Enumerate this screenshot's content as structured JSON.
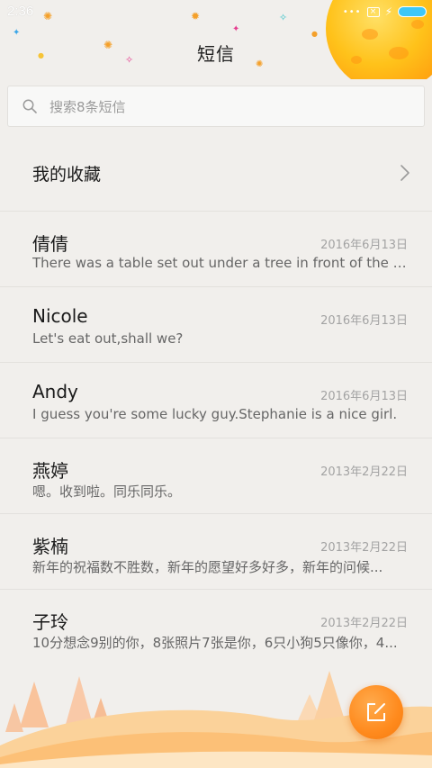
{
  "status_bar": {
    "time": "2:36",
    "battery_color": "#3ec7f7"
  },
  "header": {
    "title": "短信"
  },
  "search": {
    "placeholder": "搜索8条短信"
  },
  "favorites": {
    "label": "我的收藏"
  },
  "conversations": [
    {
      "name": "倩倩",
      "date": "2016年6月13日",
      "snippet": "There was a table set out under a tree in front of the ho..."
    },
    {
      "name": "Nicole",
      "date": "2016年6月13日",
      "snippet": "Let's eat out,shall we?"
    },
    {
      "name": "Andy",
      "date": "2016年6月13日",
      "snippet": "I guess you're some lucky guy.Stephanie is a nice girl."
    },
    {
      "name": "燕婷",
      "date": "2013年2月22日",
      "snippet": "嗯。收到啦。同乐同乐。"
    },
    {
      "name": "紫楠",
      "date": "2013年2月22日",
      "snippet": "新年的祝福数不胜数，新年的愿望好多好多，新年的问候..."
    },
    {
      "name": "子玲",
      "date": "2013年2月22日",
      "snippet": "10分想念9别的你，8张照片7张是你，6只小狗5只像你，4..."
    }
  ],
  "icons": {
    "search": "search-icon",
    "chevron": "chevron-right-icon",
    "compose": "compose-icon"
  },
  "colors": {
    "accent": "#ff8a1d",
    "background": "#f1efec"
  }
}
